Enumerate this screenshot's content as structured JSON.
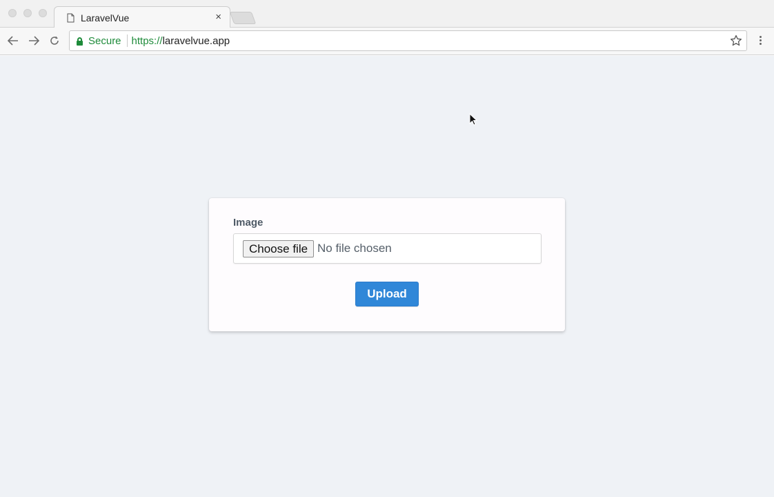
{
  "browser": {
    "tab_title": "LaravelVue",
    "tab_close": "×",
    "secure_label": "Secure",
    "url_scheme": "https://",
    "url_host": "laravelvue.app"
  },
  "form": {
    "label": "Image",
    "choose_file_label": "Choose file",
    "file_status": "No file chosen",
    "upload_label": "Upload"
  },
  "colors": {
    "accent": "#3087d8",
    "secure_green": "#1e8b3a",
    "page_background": "#eff2f6"
  }
}
